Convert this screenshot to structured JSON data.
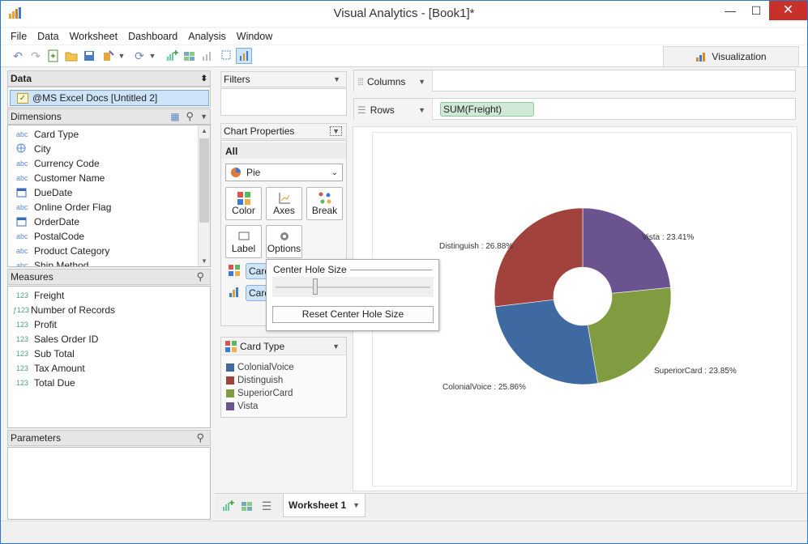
{
  "window": {
    "title": "Visual Analytics - [Book1]*",
    "minimize": "—",
    "maximize": "☐",
    "close": "✕"
  },
  "menu": [
    "File",
    "Data",
    "Worksheet",
    "Dashboard",
    "Analysis",
    "Window"
  ],
  "toolbar": {
    "visualization_tab": "Visualization"
  },
  "data_panel": {
    "header": "Data",
    "source": "@MS Excel Docs [Untitled 2]",
    "dimensions_header": "Dimensions",
    "dimensions": [
      {
        "type": "abc",
        "label": "Card Type"
      },
      {
        "type": "globe",
        "label": "City"
      },
      {
        "type": "abc",
        "label": "Currency Code"
      },
      {
        "type": "abc",
        "label": "Customer Name"
      },
      {
        "type": "date",
        "label": "DueDate"
      },
      {
        "type": "abc",
        "label": "Online Order Flag"
      },
      {
        "type": "date",
        "label": "OrderDate"
      },
      {
        "type": "abc",
        "label": "PostalCode"
      },
      {
        "type": "abc",
        "label": "Product Category"
      },
      {
        "type": "abc",
        "label": "Ship Method"
      }
    ],
    "measures_header": "Measures",
    "measures": [
      {
        "type": "123",
        "label": "Freight"
      },
      {
        "type": "f123",
        "label": "Number of Records"
      },
      {
        "type": "123",
        "label": "Profit"
      },
      {
        "type": "123",
        "label": "Sales Order ID"
      },
      {
        "type": "123",
        "label": "Sub Total"
      },
      {
        "type": "123",
        "label": "Tax Amount"
      },
      {
        "type": "123",
        "label": "Total Due"
      }
    ],
    "parameters_header": "Parameters"
  },
  "filters": {
    "header": "Filters"
  },
  "chart_properties": {
    "header": "Chart Properties",
    "section": "All",
    "chart_type": "Pie",
    "buttons": [
      "Color",
      "Axes",
      "Break",
      "Label",
      "Options"
    ],
    "pill_1": "Card",
    "pill_2": "Card"
  },
  "popup": {
    "title": "Center Hole Size",
    "reset_button": "Reset Center Hole Size",
    "slider_value": 0.25
  },
  "legend": {
    "title": "Card Type",
    "items": [
      {
        "label": "ColonialVoice",
        "color": "#3f6aa1"
      },
      {
        "label": "Distinguish",
        "color": "#a2423d"
      },
      {
        "label": "SuperiorCard",
        "color": "#819b41"
      },
      {
        "label": "Vista",
        "color": "#6b5390"
      }
    ]
  },
  "shelves": {
    "columns": "Columns",
    "rows": "Rows",
    "rows_pill": "SUM(Freight)"
  },
  "tabs": {
    "worksheet": "Worksheet 1"
  },
  "chart_data": {
    "type": "pie",
    "donut": true,
    "categories": [
      "Vista",
      "SuperiorCard",
      "ColonialVoice",
      "Distinguish"
    ],
    "values": [
      23.41,
      23.85,
      25.86,
      26.88
    ],
    "labels": [
      "Vista : 23.41%",
      "SuperiorCard : 23.85%",
      "ColonialVoice : 25.86%",
      "Distinguish : 26.88%"
    ],
    "colors": [
      "#6b5390",
      "#819b41",
      "#3f6aa1",
      "#a2423d"
    ]
  }
}
